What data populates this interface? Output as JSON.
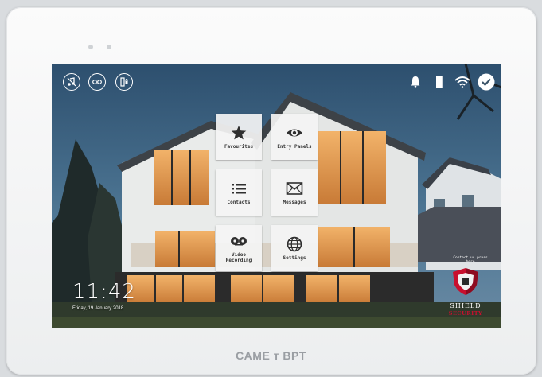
{
  "device": {
    "brand": "CAME ᴛ BPT"
  },
  "status_bar": {
    "left_icons": [
      "music-off-icon",
      "voicemail-icon",
      "door-lock-icon"
    ],
    "right_icons": [
      "bell-icon",
      "door-icon",
      "wifi-icon",
      "check-circle-icon"
    ]
  },
  "menu": {
    "favourites": "Favourites",
    "entry_panels": "Entry Panels",
    "contacts": "Contacts",
    "messages": "Messages",
    "video_recording": "Video Recording",
    "settings": "Settings"
  },
  "clock": {
    "time": "11:42",
    "date": "Friday, 19 January 2018"
  },
  "branding": {
    "contact_hint": "Contact us press here",
    "name": "SHIELD",
    "subtitle": "SECURITY",
    "accent_color": "#c8102e"
  }
}
